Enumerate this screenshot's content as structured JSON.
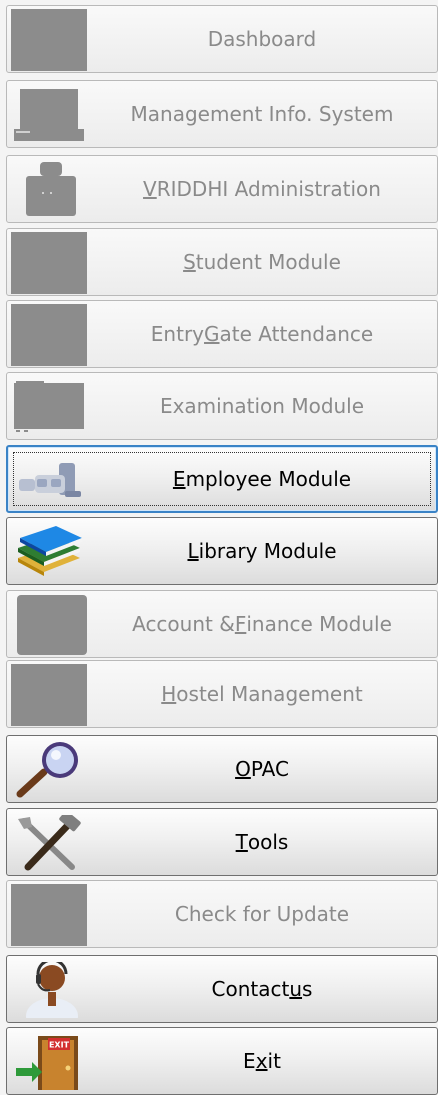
{
  "menu": {
    "items": [
      {
        "label_pre": "",
        "mnemonic": "",
        "label_post": "Dashboard",
        "enabled": false,
        "icon": "dashboard-icon"
      },
      {
        "label_pre": "",
        "mnemonic": "",
        "label_post": "Management Info. System",
        "enabled": false,
        "icon": "laptop-icon"
      },
      {
        "label_pre": "",
        "mnemonic": "V",
        "label_post": "RIDDHI Administration",
        "enabled": false,
        "icon": "admin-icon"
      },
      {
        "label_pre": "",
        "mnemonic": "S",
        "label_post": "tudent Module",
        "enabled": false,
        "icon": "student-icon"
      },
      {
        "label_pre": "Entry ",
        "mnemonic": "G",
        "label_post": "ate Attendance",
        "enabled": false,
        "icon": "attendance-icon"
      },
      {
        "label_pre": "",
        "mnemonic": "",
        "label_post": "Examination Module",
        "enabled": false,
        "icon": "examination-icon"
      },
      {
        "label_pre": "",
        "mnemonic": "E",
        "label_post": "mployee Module",
        "enabled": true,
        "focused": true,
        "icon": "employee-icon"
      },
      {
        "label_pre": "",
        "mnemonic": "L",
        "label_post": "ibrary Module",
        "enabled": true,
        "icon": "books-icon"
      },
      {
        "label_pre": "Account & ",
        "mnemonic": "F",
        "label_post": "inance Module",
        "enabled": false,
        "icon": "finance-icon"
      },
      {
        "label_pre": "",
        "mnemonic": "H",
        "label_post": "ostel Management",
        "enabled": false,
        "icon": "hostel-icon"
      },
      {
        "label_pre": "",
        "mnemonic": "O",
        "label_post": "PAC",
        "enabled": true,
        "icon": "magnifier-icon"
      },
      {
        "label_pre": "",
        "mnemonic": "T",
        "label_post": "ools",
        "enabled": true,
        "icon": "tools-icon"
      },
      {
        "label_pre": "",
        "mnemonic": "",
        "label_post": "Check for Update",
        "enabled": false,
        "icon": "update-icon"
      },
      {
        "label_pre": "Contact ",
        "mnemonic": "u",
        "label_post": "s",
        "enabled": true,
        "icon": "support-agent-icon"
      },
      {
        "label_pre": "E",
        "mnemonic": "x",
        "label_post": "it",
        "enabled": true,
        "icon": "exit-door-icon"
      }
    ]
  }
}
